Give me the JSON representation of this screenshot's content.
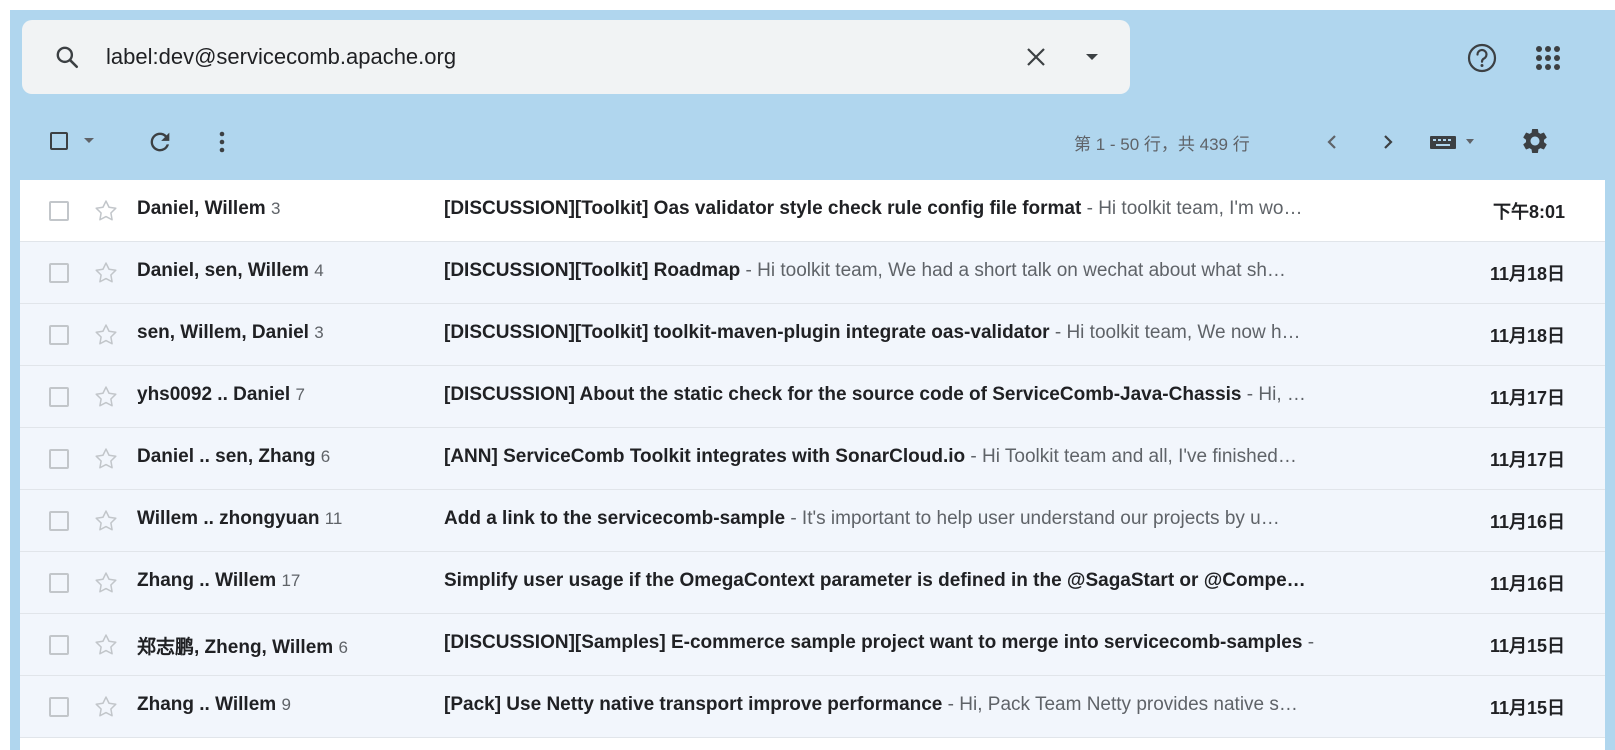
{
  "search": {
    "value": "label:dev@servicecomb.apache.org",
    "icons": [
      "search-icon",
      "clear-search-icon",
      "search-options-dropdown-icon"
    ]
  },
  "header_icons": [
    "help-icon",
    "apps-grid-icon"
  ],
  "toolbar": {
    "icons": [
      "select-checkbox",
      "select-dropdown-arrow",
      "refresh-icon",
      "more-vert-icon",
      "chevron-left-icon",
      "chevron-right-icon",
      "keyboard-icon",
      "gear-icon"
    ],
    "pager_text": "第 1 - 50 行，共 439 行"
  },
  "colors": {
    "header_bg": "#b0d6ee",
    "read_row_bg": "#f2f6fc",
    "unread_row_bg": "#ffffff",
    "snippet_text": "#5f6368"
  },
  "threads": [
    {
      "senders": [
        {
          "name": "Daniel",
          "bold": true
        },
        {
          "name": ", Willem",
          "bold": true
        }
      ],
      "count": "3",
      "subject": "[DISCUSSION][Toolkit] Oas validator style check rule config file format",
      "snippet": " - Hi toolkit team, I'm wo…",
      "date": "下午8:01",
      "unread": true
    },
    {
      "senders": [
        {
          "name": "Daniel, sen, Willem",
          "bold": true
        }
      ],
      "count": "4",
      "subject": "[DISCUSSION][Toolkit] Roadmap",
      "snippet": " - Hi toolkit team, We had a short talk on wechat about what sh…",
      "date": "11月18日",
      "unread": false
    },
    {
      "senders": [
        {
          "name": "sen, Willem, Daniel",
          "bold": true
        }
      ],
      "count": "3",
      "subject": "[DISCUSSION][Toolkit] toolkit-maven-plugin integrate oas-validator",
      "snippet": " - Hi toolkit team, We now h…",
      "date": "11月18日",
      "unread": false
    },
    {
      "senders": [
        {
          "name": "yhs0092 .. Daniel",
          "bold": true
        }
      ],
      "count": "7",
      "subject": "[DISCUSSION] About the static check for the source code of ServiceComb-Java-Chassis",
      "snippet": " - Hi, …",
      "date": "11月17日",
      "unread": false
    },
    {
      "senders": [
        {
          "name": "Daniel .. sen, Zhang",
          "bold": true
        }
      ],
      "count": "6",
      "subject": "[ANN] ServiceComb Toolkit integrates with SonarCloud.io",
      "snippet": " - Hi Toolkit team and all, I've finished…",
      "date": "11月17日",
      "unread": false
    },
    {
      "senders": [
        {
          "name": "Willem .. zhongyuan",
          "bold": true
        }
      ],
      "count": "11",
      "subject": "Add a link to the servicecomb-sample",
      "snippet": " - It's important to help user understand our projects by u…",
      "date": "11月16日",
      "unread": false
    },
    {
      "senders": [
        {
          "name": "Zhang .. Willem",
          "bold": true
        }
      ],
      "count": "17",
      "subject": "Simplify user usage if the OmegaContext parameter is defined in the @SagaStart or @Compe…",
      "snippet": "",
      "date": "11月16日",
      "unread": false
    },
    {
      "senders": [
        {
          "name": "郑志鹏, Zheng, Willem",
          "bold": true
        }
      ],
      "count": "6",
      "subject": "[DISCUSSION][Samples] E-commerce sample project want to merge into servicecomb-samples",
      "snippet": " -",
      "date": "11月15日",
      "unread": false
    },
    {
      "senders": [
        {
          "name": "Zhang .. Willem",
          "bold": true
        }
      ],
      "count": "9",
      "subject": "[Pack] Use Netty native transport improve performance",
      "snippet": " - Hi, Pack Team Netty provides native s…",
      "date": "11月15日",
      "unread": false
    }
  ]
}
